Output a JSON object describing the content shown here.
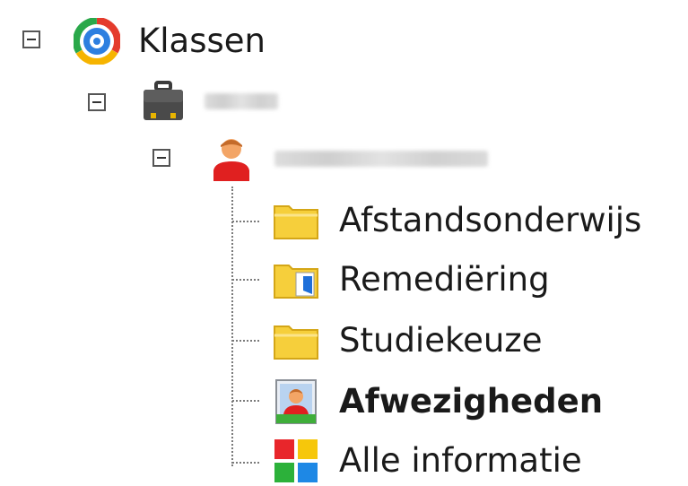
{
  "tree": {
    "root": {
      "label": "Klassen",
      "icon": "ring-globe-icon"
    },
    "class_node": {
      "label": "",
      "icon": "briefcase-icon"
    },
    "student_node": {
      "label": "",
      "icon": "person-icon"
    },
    "children": [
      {
        "label": "Afstandsonderwijs",
        "icon": "folder-icon"
      },
      {
        "label": "Remediëring",
        "icon": "folder-document-icon"
      },
      {
        "label": "Studiekeuze",
        "icon": "folder-icon"
      },
      {
        "label": "Afwezigheden",
        "icon": "portrait-icon"
      },
      {
        "label": "Alle informatie",
        "icon": "tiles-icon"
      }
    ]
  },
  "colors": {
    "folder": "#f6cf3b",
    "folder_edge": "#d4a617",
    "person_red": "#e02020",
    "tile_red": "#e8262b",
    "tile_yellow": "#f6c70b",
    "tile_green": "#2cb13a",
    "tile_blue": "#1e88e5"
  }
}
